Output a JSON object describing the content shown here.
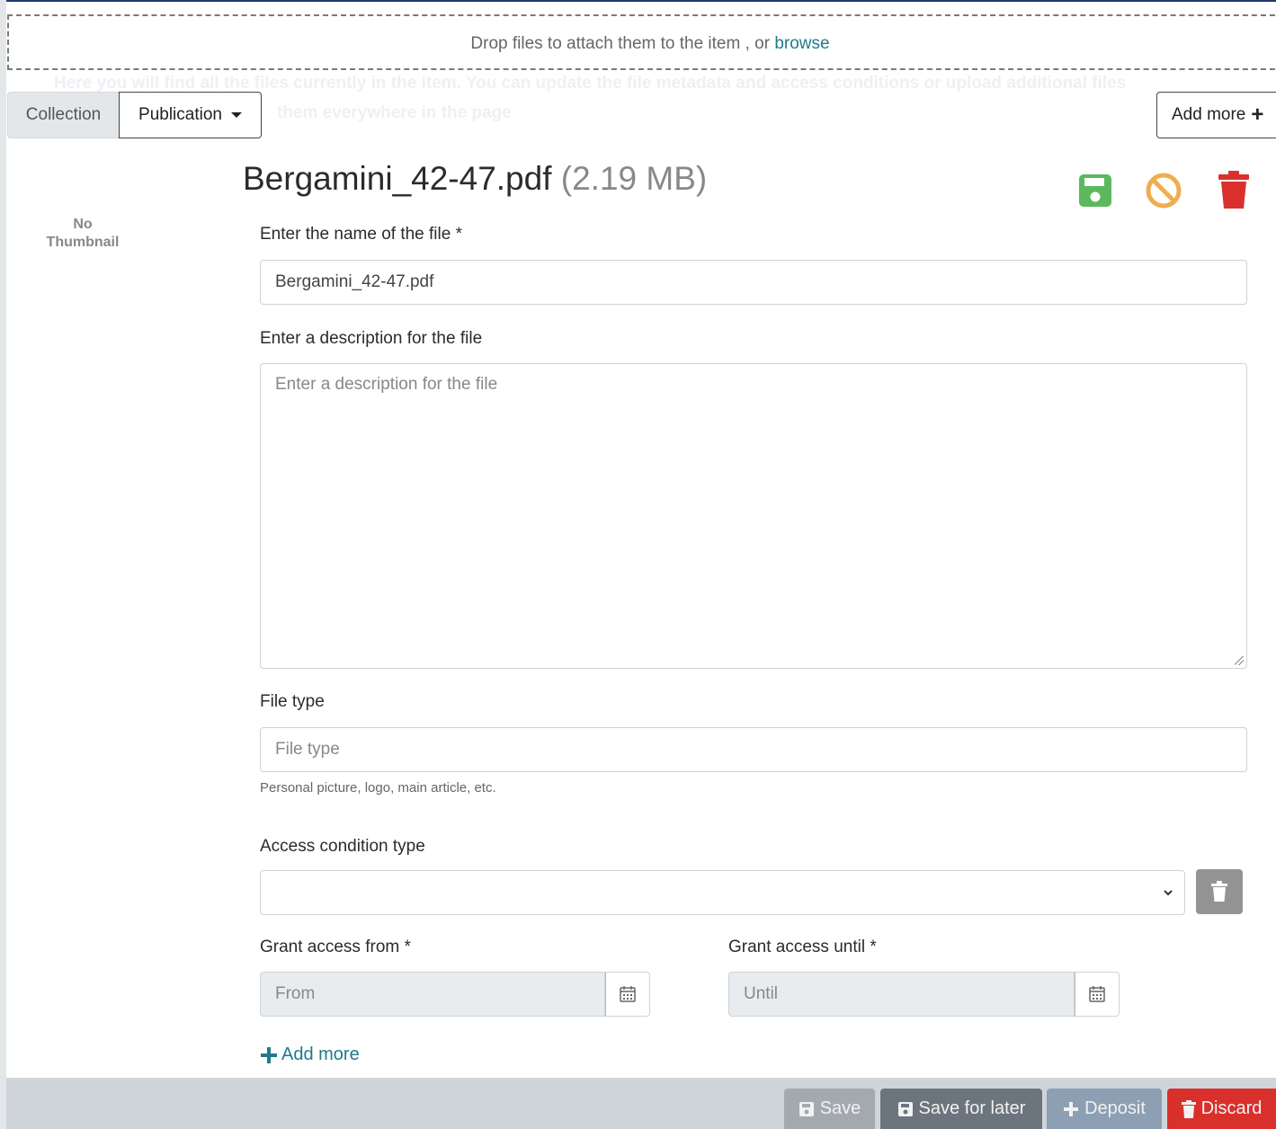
{
  "dropzone": {
    "text": "Drop files to attach them to the item , or",
    "browse_link": "browse"
  },
  "background_text": {
    "line1": "Here you will find all the files currently in the item. You can update the file metadata and access conditions or upload additional files",
    "line2": "them everywhere in the page"
  },
  "tabs": {
    "collection": "Collection",
    "publication": "Publication"
  },
  "add_more_top": "Add more",
  "thumbnail": {
    "line1": "No",
    "line2": "Thumbnail"
  },
  "file": {
    "name": "Bergamini_42-47.pdf",
    "size": "(2.19 MB)"
  },
  "actions": {
    "save_color": "#5cb85c",
    "cancel_color": "#f0ad4e",
    "delete_color": "#d9302c"
  },
  "form": {
    "name_label": "Enter the name of the file *",
    "name_value": "Bergamini_42-47.pdf",
    "description_label": "Enter a description for the file",
    "description_placeholder": "Enter a description for the file",
    "filetype_label": "File type",
    "filetype_placeholder": "File type",
    "filetype_hint": "Personal picture, logo, main article, etc.",
    "access_label": "Access condition type",
    "access_value": "",
    "grant_from_label": "Grant access from *",
    "grant_from_placeholder": "From",
    "grant_until_label": "Grant access until *",
    "grant_until_placeholder": "Until",
    "add_more": "Add more"
  },
  "footer": {
    "save": "Save",
    "save_later": "Save for later",
    "deposit": "Deposit",
    "discard": "Discard"
  }
}
